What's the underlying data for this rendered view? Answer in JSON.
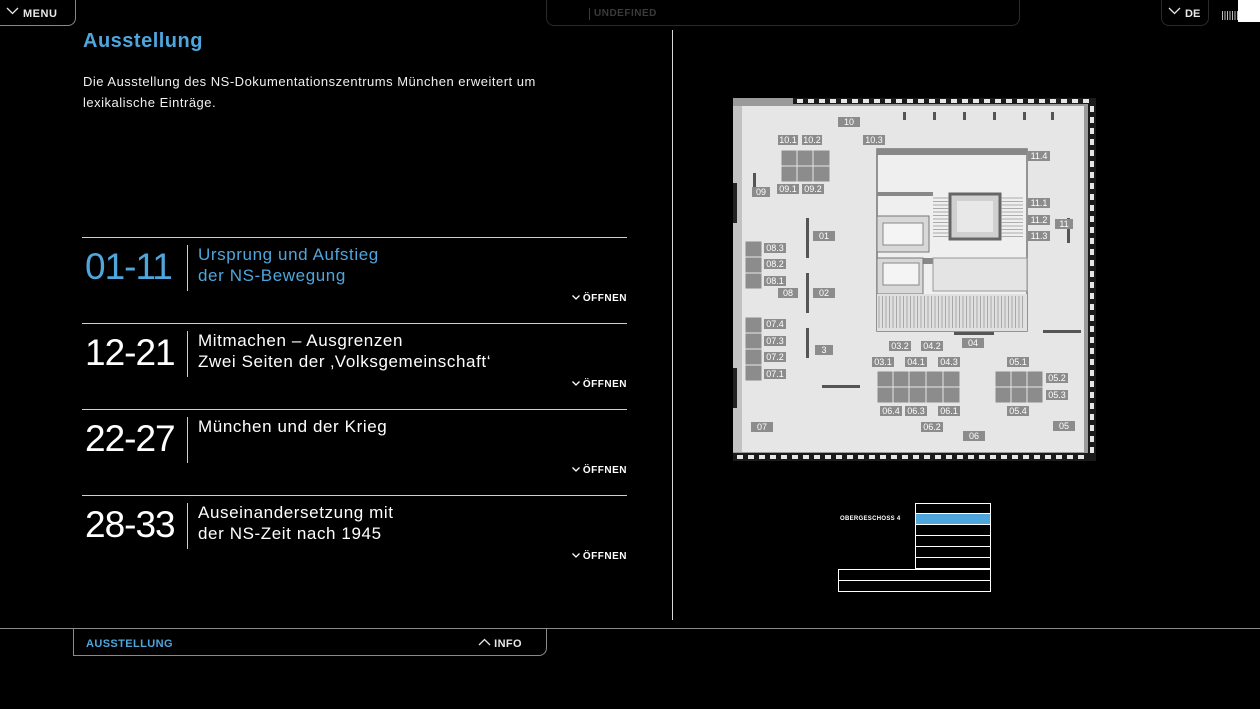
{
  "topbar": {
    "menu_label": "MENU",
    "center_label": "UNDEFINED",
    "lang_label": "DE"
  },
  "page": {
    "title": "Ausstellung",
    "intro": "Die Ausstellung des NS-Dokumentationszentrums München erweitert um lexikalische Einträge."
  },
  "sections": [
    {
      "range": "01-11",
      "title_line1": "Ursprung und Aufstieg",
      "title_line2": "der NS-Bewegung",
      "open_label": "ÖFFNEN",
      "active": true
    },
    {
      "range": "12-21",
      "title_line1": "Mitmachen – Ausgrenzen",
      "title_line2": "Zwei Seiten der ‚Volksgemeinschaft‘",
      "open_label": "ÖFFNEN",
      "active": false
    },
    {
      "range": "22-27",
      "title_line1": "München und der Krieg",
      "title_line2": "",
      "open_label": "ÖFFNEN",
      "active": false
    },
    {
      "range": "28-33",
      "title_line1": "Auseinandersetzung mit",
      "title_line2": "der NS-Zeit nach 1945",
      "open_label": "ÖFFNEN",
      "active": false
    }
  ],
  "floorplan": {
    "room_labels": [
      "10",
      "10.1",
      "10.2",
      "10.3",
      "11.4",
      "09",
      "09.1",
      "09.2",
      "11.1",
      "11.2",
      "11",
      "11.3",
      "01",
      "08.3",
      "08.2",
      "08.1",
      "08",
      "02",
      "07.4",
      "07.3",
      "07.2",
      "07.1",
      "3",
      "03.2",
      "04.2",
      "04",
      "03.1",
      "04.1",
      "04.3",
      "05.1",
      "05.2",
      "05.3",
      "06.4",
      "06.3",
      "06.1",
      "05.4",
      "06.2",
      "07",
      "06",
      "05"
    ],
    "colors": {
      "floor": "#e6e6e6",
      "room_block": "#8c8c8c",
      "wall": "#555555",
      "label_bg": "#8c8c8c"
    }
  },
  "floor_selector": {
    "current_label": "OBERGESCHOSS 4",
    "active_color": "#4ea6dc"
  },
  "bottombar": {
    "section_label": "AUSSTELLUNG",
    "info_label": "INFO"
  },
  "colors": {
    "accent": "#4ea6dc",
    "background": "#000000",
    "text": "#ffffff"
  }
}
